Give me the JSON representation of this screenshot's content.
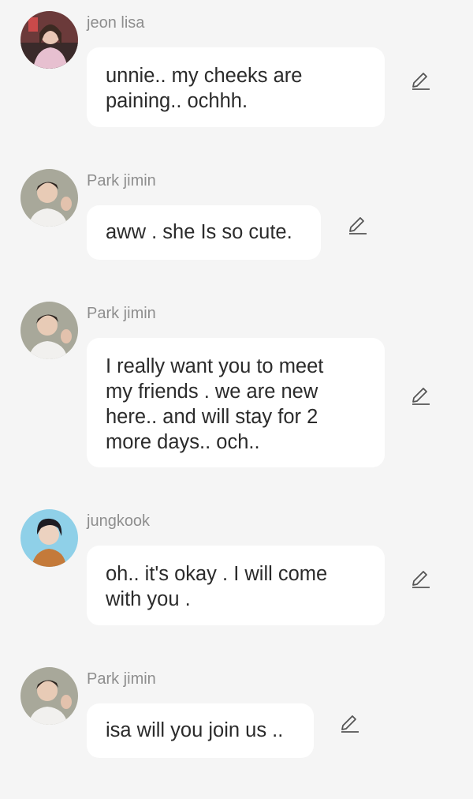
{
  "messages": [
    {
      "author": "jeon lisa",
      "lines": [
        "unnie.. my cheeks are",
        "paining.. ochhh."
      ]
    },
    {
      "author": "Park jimin",
      "lines": [
        "aww . she Is so cute."
      ]
    },
    {
      "author": "Park jimin",
      "lines": [
        "I really want you to meet",
        "my friends . we are new",
        "here.. and will stay for 2",
        "more days..  och.."
      ]
    },
    {
      "author": "jungkook",
      "lines": [
        "oh.. it's okay . I will come",
        "with you ."
      ]
    },
    {
      "author": "Park jimin",
      "lines": [
        "isa will you join us .."
      ]
    }
  ],
  "icons": {
    "avatar": "avatar",
    "edit": "pencil-edit-icon"
  },
  "colors": {
    "background": "#f5f5f5",
    "bubble": "#ffffff",
    "author": "#8e8e8e",
    "text": "#2b2b2b",
    "icon": "#555555"
  }
}
